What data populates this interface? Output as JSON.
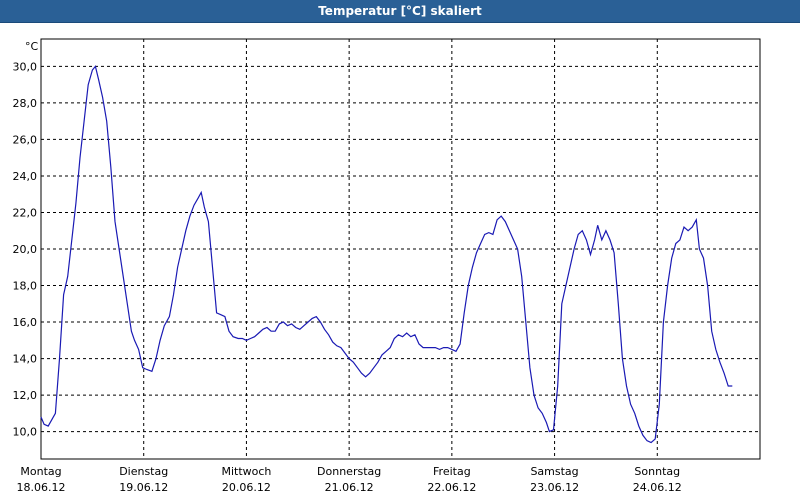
{
  "window": {
    "title": "Temperatur [°C] skaliert"
  },
  "chart_data": {
    "type": "line",
    "unit_label": "°C",
    "ylim": [
      8.5,
      31.5
    ],
    "yticks": [
      10,
      12,
      14,
      16,
      18,
      20,
      22,
      24,
      26,
      28,
      30
    ],
    "ytick_labels": [
      "10,0",
      "12,0",
      "14,0",
      "16,0",
      "18,0",
      "20,0",
      "22,0",
      "24,0",
      "26,0",
      "28,0",
      "30,0"
    ],
    "xlim": [
      0,
      7
    ],
    "grid": true,
    "line_color": "#1a1ab4",
    "day_labels": [
      {
        "day": "Montag",
        "date": "18.06.12"
      },
      {
        "day": "Dienstag",
        "date": "19.06.12"
      },
      {
        "day": "Mittwoch",
        "date": "20.06.12"
      },
      {
        "day": "Donnerstag",
        "date": "21.06.12"
      },
      {
        "day": "Freitag",
        "date": "22.06.12"
      },
      {
        "day": "Samstag",
        "date": "23.06.12"
      },
      {
        "day": "Sonntag",
        "date": "24.06.12"
      }
    ],
    "series": [
      {
        "points": [
          [
            0.0,
            10.8
          ],
          [
            0.03,
            10.4
          ],
          [
            0.07,
            10.3
          ],
          [
            0.11,
            10.7
          ],
          [
            0.14,
            11.0
          ],
          [
            0.18,
            14.0
          ],
          [
            0.22,
            17.5
          ],
          [
            0.26,
            18.5
          ],
          [
            0.3,
            20.5
          ],
          [
            0.34,
            22.5
          ],
          [
            0.38,
            25.0
          ],
          [
            0.42,
            27.0
          ],
          [
            0.46,
            29.0
          ],
          [
            0.5,
            29.8
          ],
          [
            0.53,
            30.0
          ],
          [
            0.56,
            29.3
          ],
          [
            0.6,
            28.3
          ],
          [
            0.64,
            27.0
          ],
          [
            0.68,
            24.5
          ],
          [
            0.72,
            21.5
          ],
          [
            0.76,
            20.0
          ],
          [
            0.8,
            18.5
          ],
          [
            0.84,
            17.0
          ],
          [
            0.88,
            15.5
          ],
          [
            0.91,
            15.0
          ],
          [
            0.95,
            14.5
          ],
          [
            0.99,
            13.5
          ],
          [
            1.03,
            13.4
          ],
          [
            1.08,
            13.3
          ],
          [
            1.12,
            14.0
          ],
          [
            1.16,
            15.0
          ],
          [
            1.2,
            15.8
          ],
          [
            1.25,
            16.3
          ],
          [
            1.29,
            17.5
          ],
          [
            1.33,
            19.0
          ],
          [
            1.37,
            20.0
          ],
          [
            1.41,
            21.0
          ],
          [
            1.45,
            21.8
          ],
          [
            1.49,
            22.4
          ],
          [
            1.53,
            22.8
          ],
          [
            1.56,
            23.1
          ],
          [
            1.59,
            22.3
          ],
          [
            1.63,
            21.5
          ],
          [
            1.67,
            19.0
          ],
          [
            1.71,
            16.5
          ],
          [
            1.75,
            16.4
          ],
          [
            1.79,
            16.3
          ],
          [
            1.83,
            15.5
          ],
          [
            1.87,
            15.2
          ],
          [
            1.92,
            15.1
          ],
          [
            1.96,
            15.1
          ],
          [
            2.0,
            15.0
          ],
          [
            2.04,
            15.1
          ],
          [
            2.08,
            15.2
          ],
          [
            2.12,
            15.4
          ],
          [
            2.16,
            15.6
          ],
          [
            2.2,
            15.7
          ],
          [
            2.24,
            15.5
          ],
          [
            2.28,
            15.5
          ],
          [
            2.32,
            15.9
          ],
          [
            2.36,
            16.0
          ],
          [
            2.4,
            15.8
          ],
          [
            2.44,
            15.9
          ],
          [
            2.48,
            15.7
          ],
          [
            2.52,
            15.6
          ],
          [
            2.56,
            15.8
          ],
          [
            2.6,
            16.0
          ],
          [
            2.64,
            16.2
          ],
          [
            2.68,
            16.3
          ],
          [
            2.72,
            16.0
          ],
          [
            2.76,
            15.6
          ],
          [
            2.8,
            15.3
          ],
          [
            2.84,
            14.9
          ],
          [
            2.88,
            14.7
          ],
          [
            2.92,
            14.6
          ],
          [
            2.96,
            14.3
          ],
          [
            3.0,
            14.0
          ],
          [
            3.04,
            13.8
          ],
          [
            3.08,
            13.5
          ],
          [
            3.12,
            13.2
          ],
          [
            3.16,
            13.0
          ],
          [
            3.2,
            13.2
          ],
          [
            3.24,
            13.5
          ],
          [
            3.28,
            13.8
          ],
          [
            3.32,
            14.2
          ],
          [
            3.36,
            14.4
          ],
          [
            3.4,
            14.6
          ],
          [
            3.44,
            15.1
          ],
          [
            3.48,
            15.3
          ],
          [
            3.52,
            15.2
          ],
          [
            3.56,
            15.4
          ],
          [
            3.6,
            15.2
          ],
          [
            3.64,
            15.3
          ],
          [
            3.68,
            14.8
          ],
          [
            3.72,
            14.6
          ],
          [
            3.76,
            14.6
          ],
          [
            3.8,
            14.6
          ],
          [
            3.84,
            14.6
          ],
          [
            3.88,
            14.5
          ],
          [
            3.92,
            14.6
          ],
          [
            3.96,
            14.6
          ],
          [
            4.0,
            14.5
          ],
          [
            4.04,
            14.4
          ],
          [
            4.08,
            14.8
          ],
          [
            4.12,
            16.5
          ],
          [
            4.16,
            18.0
          ],
          [
            4.2,
            19.0
          ],
          [
            4.24,
            19.8
          ],
          [
            4.28,
            20.3
          ],
          [
            4.32,
            20.8
          ],
          [
            4.36,
            20.9
          ],
          [
            4.4,
            20.8
          ],
          [
            4.44,
            21.6
          ],
          [
            4.48,
            21.8
          ],
          [
            4.52,
            21.5
          ],
          [
            4.56,
            21.0
          ],
          [
            4.6,
            20.5
          ],
          [
            4.64,
            20.0
          ],
          [
            4.68,
            18.5
          ],
          [
            4.72,
            16.0
          ],
          [
            4.76,
            13.5
          ],
          [
            4.8,
            12.0
          ],
          [
            4.84,
            11.3
          ],
          [
            4.88,
            11.0
          ],
          [
            4.92,
            10.5
          ],
          [
            4.95,
            10.0
          ],
          [
            4.99,
            10.1
          ],
          [
            5.03,
            12.5
          ],
          [
            5.07,
            17.0
          ],
          [
            5.11,
            18.0
          ],
          [
            5.15,
            19.0
          ],
          [
            5.19,
            20.0
          ],
          [
            5.23,
            20.8
          ],
          [
            5.27,
            21.0
          ],
          [
            5.31,
            20.5
          ],
          [
            5.35,
            19.7
          ],
          [
            5.39,
            20.5
          ],
          [
            5.42,
            21.3
          ],
          [
            5.46,
            20.5
          ],
          [
            5.5,
            21.0
          ],
          [
            5.54,
            20.5
          ],
          [
            5.58,
            19.8
          ],
          [
            5.62,
            17.0
          ],
          [
            5.66,
            14.0
          ],
          [
            5.7,
            12.5
          ],
          [
            5.74,
            11.5
          ],
          [
            5.78,
            11.0
          ],
          [
            5.82,
            10.3
          ],
          [
            5.86,
            9.8
          ],
          [
            5.9,
            9.5
          ],
          [
            5.94,
            9.4
          ],
          [
            5.98,
            9.6
          ],
          [
            6.02,
            11.5
          ],
          [
            6.06,
            16.0
          ],
          [
            6.1,
            18.0
          ],
          [
            6.14,
            19.5
          ],
          [
            6.18,
            20.3
          ],
          [
            6.22,
            20.5
          ],
          [
            6.26,
            21.2
          ],
          [
            6.3,
            21.0
          ],
          [
            6.34,
            21.2
          ],
          [
            6.38,
            21.6
          ],
          [
            6.41,
            20.0
          ],
          [
            6.45,
            19.5
          ],
          [
            6.49,
            18.0
          ],
          [
            6.53,
            15.5
          ],
          [
            6.57,
            14.5
          ],
          [
            6.61,
            13.8
          ],
          [
            6.65,
            13.2
          ],
          [
            6.69,
            12.5
          ],
          [
            6.73,
            12.5
          ]
        ]
      }
    ]
  }
}
